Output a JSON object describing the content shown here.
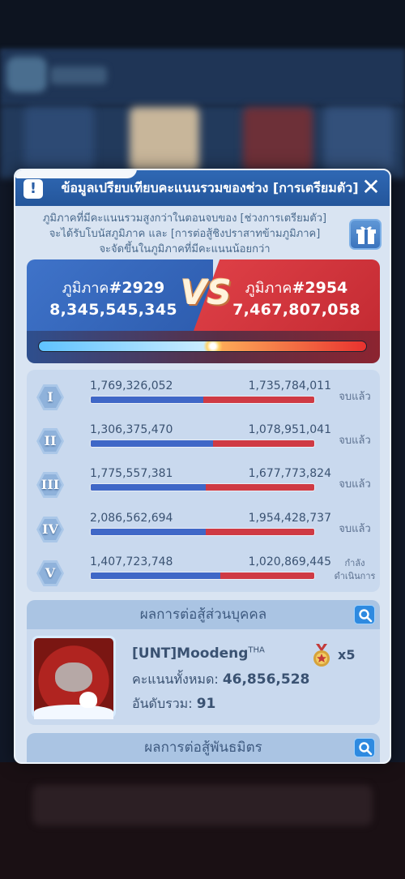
{
  "dialog": {
    "title": "ข้อมูลเปรียบเทียบคะแนนรวมของช่วง [การเตรียมตัว]",
    "description_lines": [
      "ภูมิภาคที่มีคะแนนรวมสูงกว่าในตอนจบของ [ช่วงการเตรียมตัว]",
      "จะได้รับโบนัสภูมิภาค และ [การต่อสู้ชิงปราสาทข้ามภูมิภาค]",
      "จะจัดขึ้นในภูมิภาคที่มีคะแนนน้อยกว่า"
    ],
    "icons": {
      "warning": "warning-icon",
      "close": "close-icon",
      "gift": "gift-icon"
    }
  },
  "versus": {
    "left": {
      "label": "ภูมิภาค",
      "number": "#2929",
      "score": "8,345,545,345"
    },
    "right": {
      "label": "ภูมิภาค",
      "number": "#2954",
      "score": "7,467,807,058"
    },
    "vs_text": "VS",
    "left_share": 0.53,
    "colors": {
      "left": "#3f73c9",
      "right": "#e04148"
    }
  },
  "rounds": [
    {
      "numeral": "I",
      "left": "1,769,326,052",
      "right": "1,735,784,011",
      "status": "จบแล้ว",
      "left_share": 0.505
    },
    {
      "numeral": "II",
      "left": "1,306,375,470",
      "right": "1,078,951,041",
      "status": "จบแล้ว",
      "left_share": 0.548
    },
    {
      "numeral": "III",
      "left": "1,775,557,381",
      "right": "1,677,773,824",
      "status": "จบแล้ว",
      "left_share": 0.514
    },
    {
      "numeral": "IV",
      "left": "2,086,562,694",
      "right": "1,954,428,737",
      "status": "จบแล้ว",
      "left_share": 0.516
    },
    {
      "numeral": "V",
      "left": "1,407,723,748",
      "right": "1,020,869,445",
      "status": "กำลังดำเนินการ",
      "left_share": 0.58
    }
  ],
  "individual": {
    "title": "ผลการต่อสู้ส่วนบุคคล",
    "player_name": "[UNT]Moodeng",
    "player_tag": "THA",
    "total_label": "คะแนนทั้งหมด: ",
    "total_value": "46,856,528",
    "rank_label": "อันดับรวม: ",
    "rank_value": "91",
    "medal_count": "x5",
    "icons": {
      "search": "search-icon",
      "medal": "medal-icon"
    }
  },
  "alliance": {
    "title": "ผลการต่อสู้พันธมิตร"
  }
}
